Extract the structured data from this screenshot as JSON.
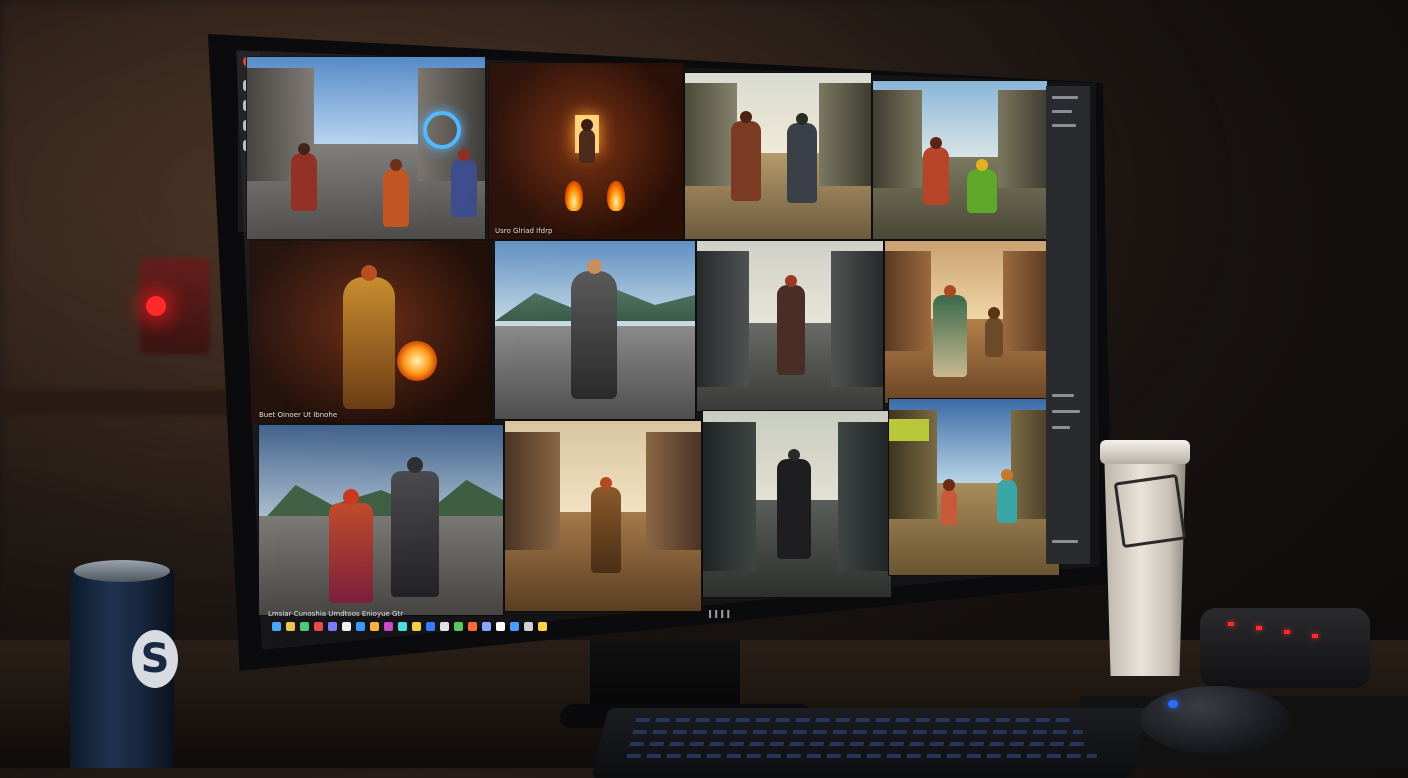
{
  "scene": {
    "monitor_brand": "IIII",
    "can_logo": "S"
  },
  "tiles": [
    {
      "caption": ""
    },
    {
      "caption": "Usro Glriad Ifdrp"
    },
    {
      "caption": ""
    },
    {
      "caption": ""
    },
    {
      "caption": "Buet Oinoer Ut Ibnohe"
    },
    {
      "caption": ""
    },
    {
      "caption": ""
    },
    {
      "caption": ""
    },
    {
      "caption": ""
    },
    {
      "caption": ""
    },
    {
      "caption": ""
    },
    {
      "caption": ""
    }
  ],
  "taskbar": {
    "text": "Lmsiar Cunoshia Umdtoos Enioyue Gtr"
  },
  "colors": {
    "fire": "#ff8a00",
    "portal": "#4fb7ff",
    "record": "#e53935",
    "mouse_led": "#2a6cff"
  }
}
